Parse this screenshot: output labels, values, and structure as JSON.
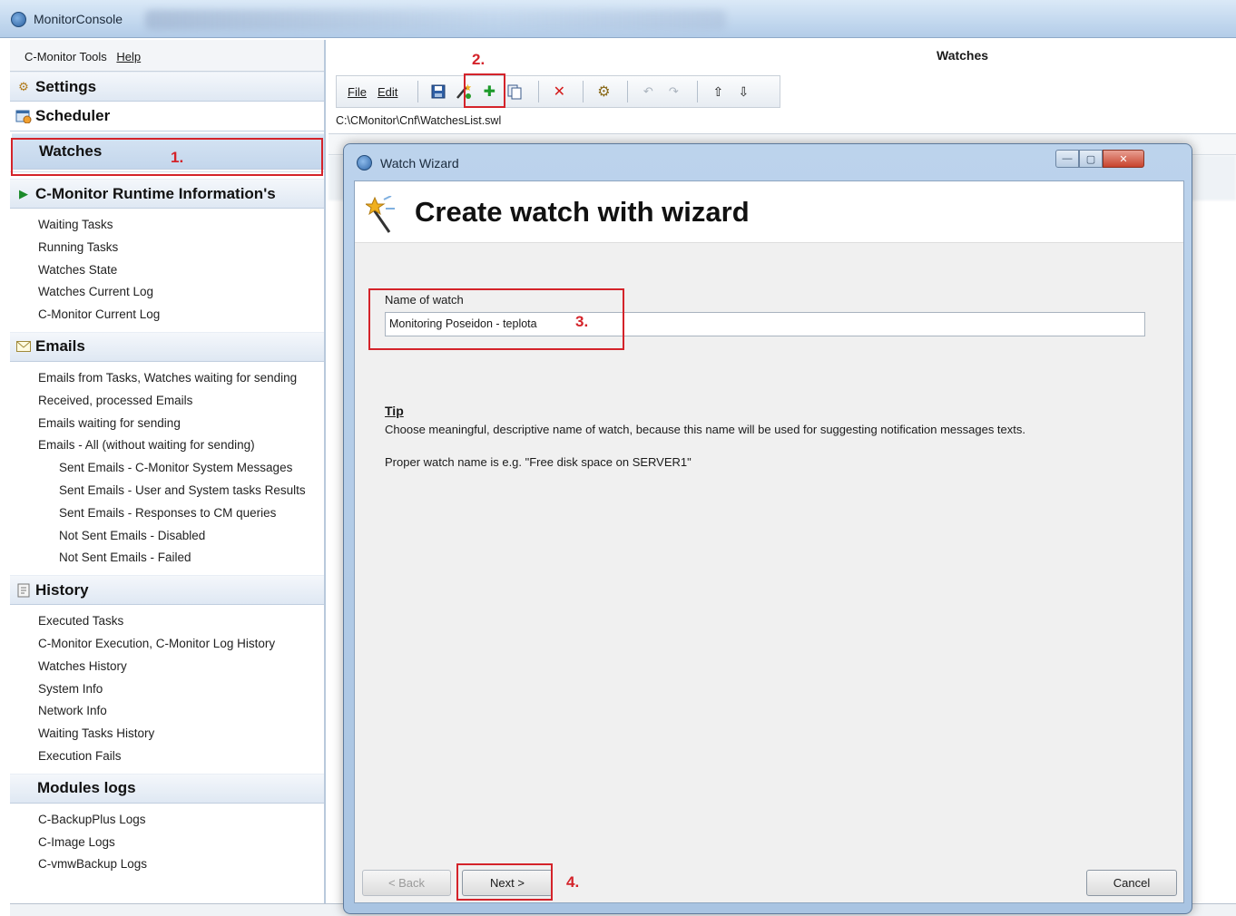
{
  "window": {
    "title": "MonitorConsole"
  },
  "sidebar": {
    "menu": [
      "C-Monitor Tools",
      "Help"
    ],
    "settings_label": "Settings",
    "scheduler_label": "Scheduler",
    "watches_label": "Watches",
    "runtime": {
      "title": "C-Monitor Runtime Information's",
      "items": [
        "Waiting Tasks",
        "Running Tasks",
        "Watches State",
        "Watches Current Log",
        "C-Monitor Current Log"
      ]
    },
    "emails": {
      "title": "Emails",
      "items": [
        "Emails from Tasks, Watches waiting for sending",
        "Received, processed Emails",
        "Emails waiting for sending",
        "Emails - All (without waiting for sending)"
      ],
      "sub_items": [
        "Sent Emails - C-Monitor System Messages",
        "Sent Emails - User and System tasks Results",
        "Sent Emails - Responses to CM queries",
        "Not Sent Emails - Disabled",
        "Not Sent Emails - Failed"
      ]
    },
    "history": {
      "title": "History",
      "items": [
        "Executed Tasks",
        "C-Monitor Execution, C-Monitor Log History",
        "Watches History",
        "System Info",
        "Network Info",
        "Waiting Tasks History",
        "Execution Fails"
      ]
    },
    "modules": {
      "title": "Modules logs",
      "items": [
        "C-BackupPlus Logs",
        "C-Image Logs",
        "C-vmwBackup Logs"
      ]
    }
  },
  "main": {
    "title": "Watches",
    "menu": [
      "File",
      "Edit"
    ],
    "path": "C:\\CMonitor\\Cnf\\WatchesList.swl"
  },
  "dialog": {
    "title": "Watch Wizard",
    "heading": "Create watch with wizard",
    "name_label": "Name of watch",
    "name_value": "Monitoring Poseidon - teplota",
    "tip_title": "Tip",
    "tip_text": "Choose meaningful, descriptive name of watch, because this name will be used for suggesting notification messages texts.",
    "tip_example": "Proper watch name is e.g. \"Free disk space on SERVER1\"",
    "back_label": "< Back",
    "next_label": "Next >",
    "cancel_label": "Cancel"
  },
  "annotations": {
    "step1": "1.",
    "step2": "2.",
    "step3": "3.",
    "step4": "4."
  },
  "colors": {
    "highlight": "#d4232a",
    "titlebar": "#c4d9ef",
    "nav_header": "#dfe8f3"
  }
}
